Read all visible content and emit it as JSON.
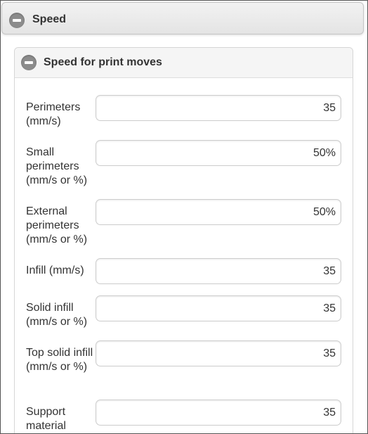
{
  "section": {
    "title": "Speed",
    "icon": "minus-circle-icon"
  },
  "subsection": {
    "title": "Speed for print moves",
    "icon": "minus-circle-icon"
  },
  "fields": [
    {
      "label": "Perimeters (mm/s)",
      "value": "35"
    },
    {
      "label": "Small perimeters (mm/s or %)",
      "value": "50%"
    },
    {
      "label": "External perimeters (mm/s or %)",
      "value": "50%"
    },
    {
      "label": "Infill (mm/s)",
      "value": "35"
    },
    {
      "label": "Solid infill (mm/s or %)",
      "value": "35"
    },
    {
      "label": "Top solid infill (mm/s or %)",
      "value": "35"
    },
    {
      "label": "Support material",
      "value": "35"
    }
  ]
}
